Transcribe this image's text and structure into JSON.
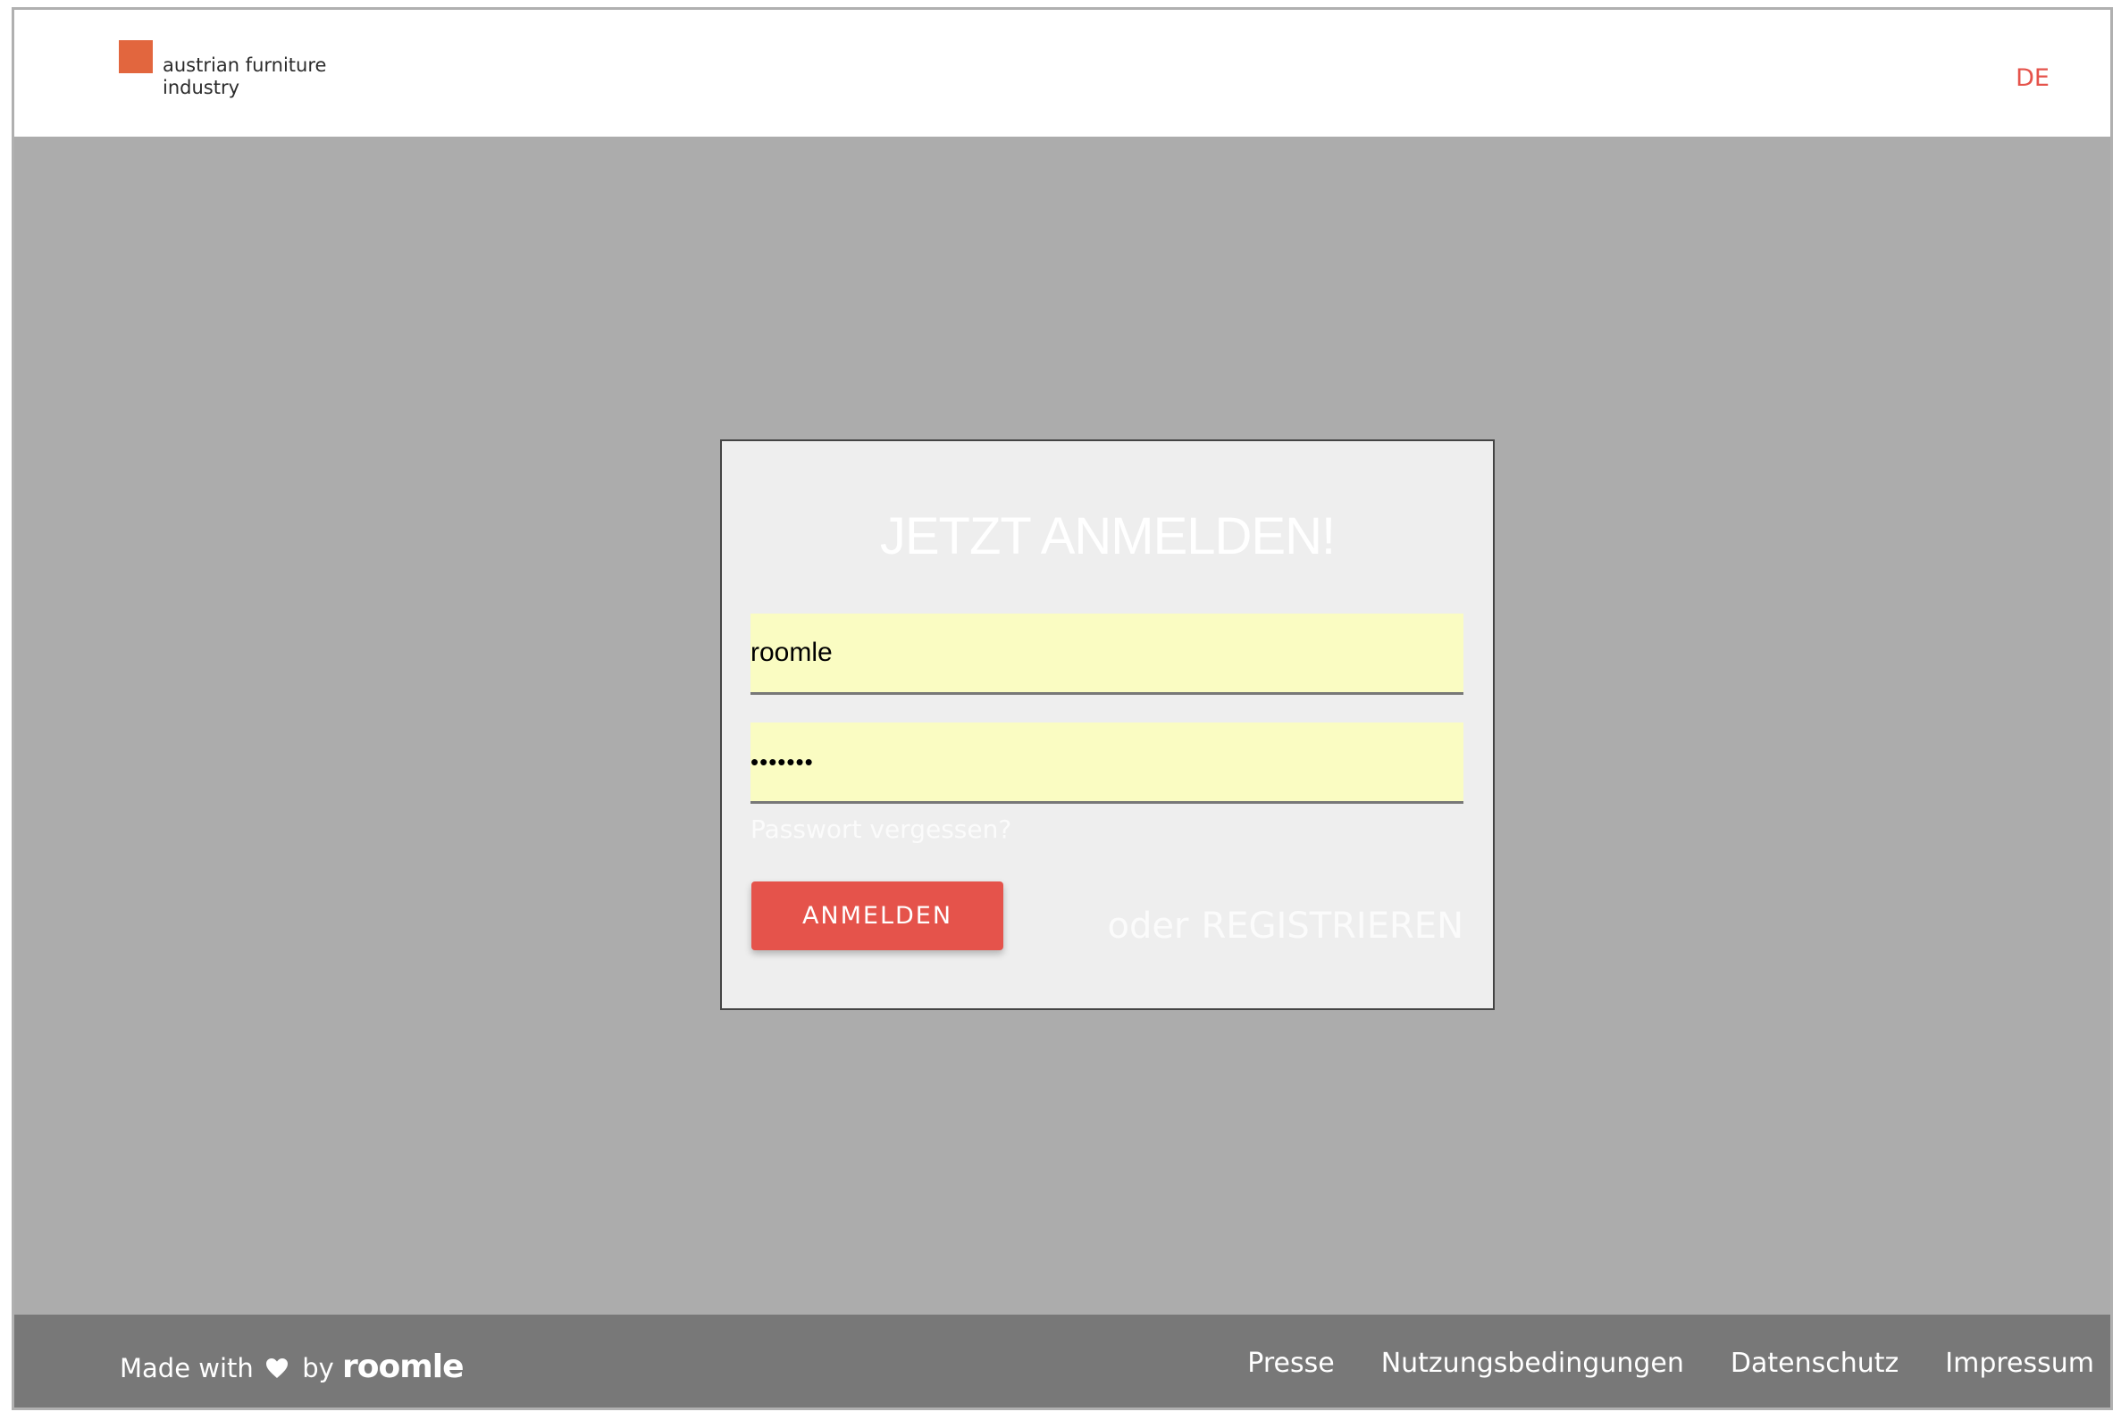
{
  "header": {
    "logo_text_line1": "austrian furniture",
    "logo_text_line2": "industry",
    "language": "DE",
    "logo_color": "#e2663e"
  },
  "login": {
    "title": "JETZT ANMELDEN!",
    "username_value": "roomle",
    "password_value": "•••••••",
    "forgot_password": "Passwort vergessen?",
    "login_button": "ANMELDEN",
    "or_label": "oder",
    "register_link": "REGISTRIEREN",
    "accent_color": "#e5534b"
  },
  "footer": {
    "made_with": "Made with",
    "heart_icon": "heart-icon",
    "by": "by",
    "brand": "roomle",
    "links": [
      "Presse",
      "Nutzungsbedingungen",
      "Datenschutz",
      "Impressum"
    ]
  }
}
